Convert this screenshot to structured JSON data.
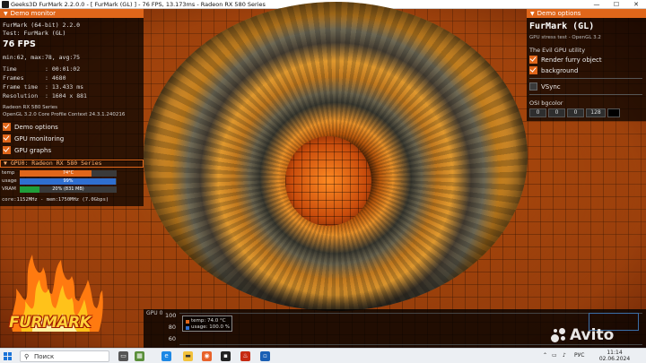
{
  "window": {
    "title": "Geeks3D FurMark 2.2.0.0 - [ FurMark (GL) ] - 76 FPS, 13.173ms - Radeon RX 580 Series",
    "minimize": "—",
    "maximize": "☐",
    "close": "✕"
  },
  "demo_monitor": {
    "header": "Demo monitor",
    "app_line": "FurMark (64-bit) 2.2.0",
    "test_line": "Test: FurMark (GL)",
    "fps": "76 FPS",
    "minmax": "min:62, max:78, avg:75",
    "stats": [
      {
        "label": "Time",
        "value": ": 00:01:02"
      },
      {
        "label": "Frames",
        "value": ": 4680"
      },
      {
        "label": "Frame time",
        "value": ": 13.433 ms"
      },
      {
        "label": "Resolution",
        "value": ": 1604 x 881"
      }
    ],
    "gpu_name": "Radeon RX 580 Series",
    "gl_info": "OpenGL 3.2.0 Core Profile Context 24.3.1.240216",
    "options": [
      {
        "label": "Demo options",
        "checked": true
      },
      {
        "label": "GPU monitoring",
        "checked": true
      },
      {
        "label": "GPU graphs",
        "checked": true
      }
    ]
  },
  "gpu0": {
    "header": "GPU0: Radeon RX 580 Series",
    "bars": [
      {
        "label": "temp",
        "text": "74°C",
        "fraction": 0.74,
        "color": "#e0661a"
      },
      {
        "label": "usage",
        "text": "99%",
        "fraction": 0.99,
        "color": "#2f6fd0"
      },
      {
        "label": "VRAM",
        "text": "20% (831 MB)",
        "fraction": 0.2,
        "color": "#1f9e3a"
      }
    ],
    "clocks": "core:1152MHz - mem:1750MHz (7.0Gbps)"
  },
  "logo": {
    "text": "FURMARK"
  },
  "demo_options": {
    "header": "Demo options",
    "title": "FurMark (GL)",
    "subtitle": "GPU stress test - OpenGL 3.2",
    "utility": "The Evil GPU utility",
    "checks": [
      {
        "label": "Render furry object",
        "checked": true
      },
      {
        "label": "background",
        "checked": true
      }
    ],
    "vsync": {
      "label": "VSync",
      "checked": false
    },
    "osi_label": "OSI bgcolor",
    "osi_values": [
      "0",
      "0",
      "0",
      "128"
    ]
  },
  "graph": {
    "label": "GPU 0",
    "y_ticks": [
      "100",
      "80",
      "60"
    ],
    "legend": [
      {
        "label": "temp: 74.0 °C",
        "color": "#e0661a"
      },
      {
        "label": "usage: 100.0 %",
        "color": "#2f6fd0"
      }
    ]
  },
  "taskbar": {
    "search_placeholder": "Поиск",
    "lang": "РУС",
    "time": "11:14",
    "date": "02.06.2024"
  },
  "watermark": {
    "text": "Avito"
  },
  "colors": {
    "accent": "#e0661a",
    "usage": "#2f6fd0",
    "vram": "#1f9e3a"
  }
}
